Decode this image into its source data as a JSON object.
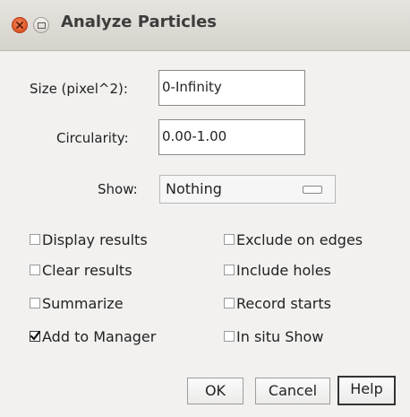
{
  "window": {
    "title": "Analyze Particles"
  },
  "fields": {
    "size_label": "Size (pixel^2):",
    "size_value": "0-Infinity",
    "circularity_label": "Circularity:",
    "circularity_value": "0.00-1.00",
    "show_label": "Show:",
    "show_value": "Nothing"
  },
  "checkboxes": [
    {
      "label": "Display results",
      "checked": false
    },
    {
      "label": "Exclude on edges",
      "checked": false
    },
    {
      "label": "Clear results",
      "checked": false
    },
    {
      "label": "Include holes",
      "checked": false
    },
    {
      "label": "Summarize",
      "checked": false
    },
    {
      "label": "Record starts",
      "checked": false
    },
    {
      "label": "Add to Manager",
      "checked": true
    },
    {
      "label": "In situ Show",
      "checked": false
    }
  ],
  "buttons": {
    "ok": "OK",
    "cancel": "Cancel",
    "help": "Help"
  }
}
